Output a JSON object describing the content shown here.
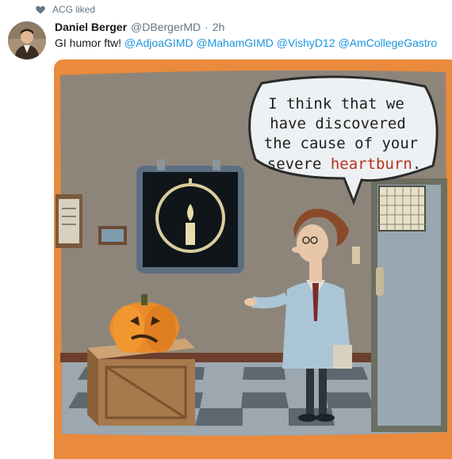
{
  "social_context": {
    "icon": "heart-icon",
    "label": "ACG liked"
  },
  "tweet": {
    "author_name": "Daniel Berger",
    "author_handle": "@DBergerMD",
    "separator": "·",
    "timestamp": "2h",
    "text_prefix": "GI humor ftw!",
    "mentions": [
      "@AdjoaGIMD",
      "@MahamGIMD",
      "@VishyD12",
      "@AmCollegeGastro"
    ]
  },
  "cartoon": {
    "speech_lines": [
      "I think that we",
      "have discovered",
      "the cause of your",
      "severe "
    ],
    "speech_highlight": "heartburn",
    "speech_end": "."
  },
  "colors": {
    "accent": "#1b95e0",
    "muted": "#657786",
    "highlight_text": "#b8311f"
  }
}
